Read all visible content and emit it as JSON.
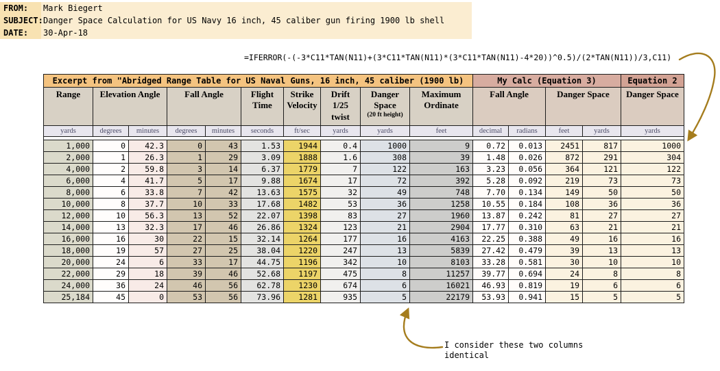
{
  "memo": {
    "from_label": "FROM:",
    "from_value": "Mark Biegert",
    "subject_label": "SUBJECT:",
    "subject_value": "Danger Space Calculation for US Navy 16 inch, 45 caliber gun firing 1900 lb shell",
    "date_label": "DATE:",
    "date_value": "30-Apr-18"
  },
  "formula": "=IFERROR(-(-3*C11*TAN(N11)+(3*C11*TAN(N11)*(3*C11*TAN(N11)-4*20))^0.5)/(2*TAN(N11))/3,C11)",
  "table": {
    "title_excerpt": "Excerpt from \"Abridged Range Table for US Naval Guns, 16 inch, 45 caliber (1900 lb)",
    "title_mycalc": "My Calc (Equation 3)",
    "title_eq2": "Equation 2",
    "headers": {
      "range": "Range",
      "elevation_angle": "Elevation Angle",
      "fall_angle": "Fall Angle",
      "flight_time": [
        "Flight",
        "Time"
      ],
      "strike_velocity": [
        "Strike",
        "Velocity"
      ],
      "drift": [
        "Drift",
        "1/25",
        "twist"
      ],
      "danger_space": [
        "Danger",
        "Space",
        "(20 ft height)"
      ],
      "maximum_ordinate": [
        "Maximum",
        "Ordinate"
      ],
      "mycalc_fall_angle": "Fall Angle",
      "mycalc_danger_space": "Danger Space",
      "eq2_danger_space": "Danger Space"
    },
    "units": [
      "yards",
      "degrees",
      "minutes",
      "degrees",
      "minutes",
      "seconds",
      "ft/sec",
      "yards",
      "yards",
      "feet",
      "decimal",
      "radians",
      "feet",
      "yards",
      "yards"
    ],
    "rows": [
      [
        "1,000",
        "0",
        "42.3",
        "0",
        "43",
        "1.53",
        "1944",
        "0.4",
        "1000",
        "9",
        "0.72",
        "0.013",
        "2451",
        "817",
        "1000"
      ],
      [
        "2,000",
        "1",
        "26.3",
        "1",
        "29",
        "3.09",
        "1888",
        "1.6",
        "308",
        "39",
        "1.48",
        "0.026",
        "872",
        "291",
        "304"
      ],
      [
        "4,000",
        "2",
        "59.8",
        "3",
        "14",
        "6.37",
        "1779",
        "7",
        "122",
        "163",
        "3.23",
        "0.056",
        "364",
        "121",
        "122"
      ],
      [
        "6,000",
        "4",
        "41.7",
        "5",
        "17",
        "9.88",
        "1674",
        "17",
        "72",
        "392",
        "5.28",
        "0.092",
        "219",
        "73",
        "73"
      ],
      [
        "8,000",
        "6",
        "33.8",
        "7",
        "42",
        "13.63",
        "1575",
        "32",
        "49",
        "748",
        "7.70",
        "0.134",
        "149",
        "50",
        "50"
      ],
      [
        "10,000",
        "8",
        "37.7",
        "10",
        "33",
        "17.68",
        "1482",
        "53",
        "36",
        "1258",
        "10.55",
        "0.184",
        "108",
        "36",
        "36"
      ],
      [
        "12,000",
        "10",
        "56.3",
        "13",
        "52",
        "22.07",
        "1398",
        "83",
        "27",
        "1960",
        "13.87",
        "0.242",
        "81",
        "27",
        "27"
      ],
      [
        "14,000",
        "13",
        "32.3",
        "17",
        "46",
        "26.86",
        "1324",
        "123",
        "21",
        "2904",
        "17.77",
        "0.310",
        "63",
        "21",
        "21"
      ],
      [
        "16,000",
        "16",
        "30",
        "22",
        "15",
        "32.14",
        "1264",
        "177",
        "16",
        "4163",
        "22.25",
        "0.388",
        "49",
        "16",
        "16"
      ],
      [
        "18,000",
        "19",
        "57",
        "27",
        "25",
        "38.04",
        "1220",
        "247",
        "13",
        "5839",
        "27.42",
        "0.479",
        "39",
        "13",
        "13"
      ],
      [
        "20,000",
        "24",
        "6",
        "33",
        "17",
        "44.75",
        "1196",
        "342",
        "10",
        "8103",
        "33.28",
        "0.581",
        "30",
        "10",
        "10"
      ],
      [
        "22,000",
        "29",
        "18",
        "39",
        "46",
        "52.68",
        "1197",
        "475",
        "8",
        "11257",
        "39.77",
        "0.694",
        "24",
        "8",
        "8"
      ],
      [
        "24,000",
        "36",
        "24",
        "46",
        "56",
        "62.78",
        "1230",
        "674",
        "6",
        "16021",
        "46.93",
        "0.819",
        "19",
        "6",
        "6"
      ],
      [
        "25,184",
        "45",
        "0",
        "53",
        "56",
        "73.96",
        "1281",
        "935",
        "5",
        "22179",
        "53.93",
        "0.941",
        "15",
        "5",
        "5"
      ]
    ]
  },
  "annotation": {
    "line1": "I consider these two columns",
    "line2": "identical"
  },
  "colors": {
    "arrow": "#A57D1E",
    "memo_bg": "#FBEDD1",
    "memo_label_bg": "#F8E2B2",
    "excerpt_title_bg": "#F4C380",
    "mycalc_title_bg": "#D7ACA0",
    "eq2_title_bg": "#D2A294",
    "header_bg": "#D8D1C5",
    "strike_velocity_bg": "#ECD468",
    "fall_angle_bg": "#D2C6AF",
    "mycalc_data_bg": "#FBF2E0"
  }
}
